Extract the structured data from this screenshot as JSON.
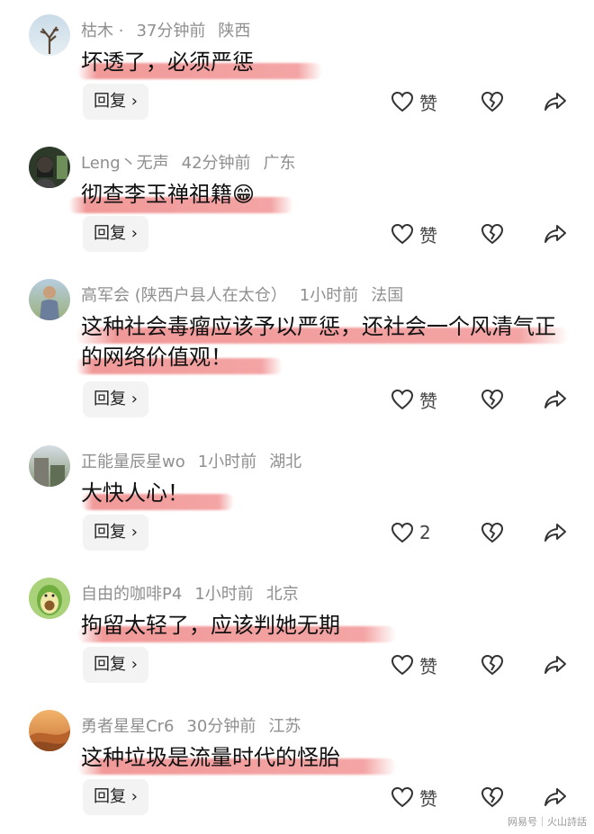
{
  "comments": [
    {
      "user": "枯木 ·",
      "time": "37分钟前",
      "location": "陕西",
      "text": "坏透了，必须严惩",
      "reply_label": "回复",
      "like_label": "赞",
      "avatar": "tree-avatar"
    },
    {
      "user": "Leng丶无声",
      "time": "42分钟前",
      "location": "广东",
      "text": "彻查李玉禅祖籍😁",
      "reply_label": "回复",
      "like_label": "赞",
      "avatar": "person-avatar"
    },
    {
      "user": "高军会 (陕西户县人在太仓）",
      "time": "1小时前",
      "location": "法国",
      "text": "这种社会毒瘤应该予以严惩，还社会一个风清气正的网络价值观！",
      "reply_label": "回复",
      "like_label": "赞",
      "avatar": "man-avatar"
    },
    {
      "user": "正能量辰星wo",
      "time": "1小时前",
      "location": "湖北",
      "text": "大快人心！",
      "reply_label": "回复",
      "like_label": "2",
      "avatar": "building-avatar"
    },
    {
      "user": "自由的咖啡P4",
      "time": "1小时前",
      "location": "北京",
      "text": "拘留太轻了，应该判她无期",
      "reply_label": "回复",
      "like_label": "赞",
      "avatar": "avocado-avatar"
    },
    {
      "user": "勇者星星Cr6",
      "time": "30分钟前",
      "location": "江苏",
      "text": "这种垃圾是流量时代的怪胎",
      "reply_label": "回复",
      "like_label": "赞",
      "avatar": "desert-avatar"
    }
  ],
  "watermark": "网易号｜火山詩話"
}
